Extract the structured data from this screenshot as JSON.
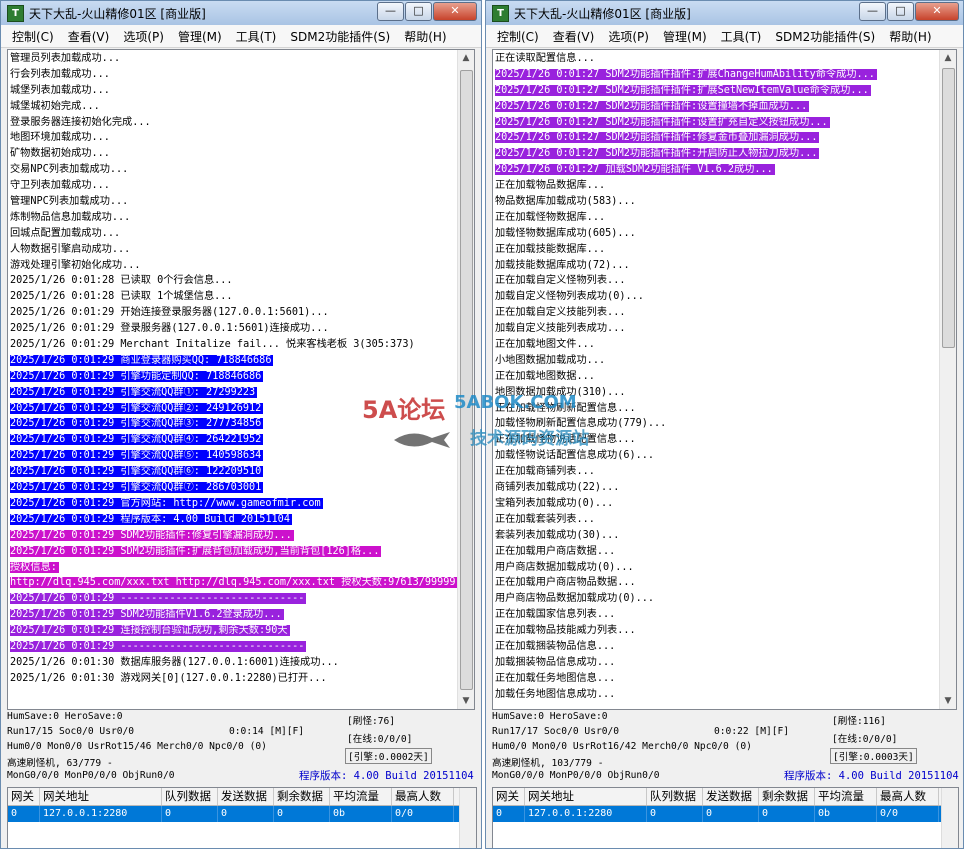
{
  "left": {
    "title": "天下大乱-火山精修01区 [商业版]",
    "buttons": {
      "min": "—",
      "max": "□",
      "close": "✕"
    },
    "menu": [
      "控制(C)",
      "查看(V)",
      "选项(P)",
      "管理(M)",
      "工具(T)",
      "SDM2功能插件(S)",
      "帮助(H)"
    ],
    "log": [
      {
        "t": "管理员列表加载成功...",
        "h": ""
      },
      {
        "t": "行会列表加载成功...",
        "h": ""
      },
      {
        "t": "城堡列表加载成功...",
        "h": ""
      },
      {
        "t": "城堡城初始完成...",
        "h": ""
      },
      {
        "t": "登录服务器连接初始化完成...",
        "h": ""
      },
      {
        "t": "地图环境加载成功...",
        "h": ""
      },
      {
        "t": "矿物数据初始成功...",
        "h": ""
      },
      {
        "t": "交易NPC列表加载成功...",
        "h": ""
      },
      {
        "t": "守卫列表加载成功...",
        "h": ""
      },
      {
        "t": "管理NPC列表加载成功...",
        "h": ""
      },
      {
        "t": "炼制物品信息加载成功...",
        "h": ""
      },
      {
        "t": "回城点配置加载成功...",
        "h": ""
      },
      {
        "t": "人物数据引擎启动成功...",
        "h": ""
      },
      {
        "t": "游戏处理引擎初始化成功...",
        "h": ""
      },
      {
        "t": "2025/1/26 0:01:28 已读取 0个行会信息...",
        "h": ""
      },
      {
        "t": "2025/1/26 0:01:28 已读取 1个城堡信息...",
        "h": ""
      },
      {
        "t": "2025/1/26 0:01:29 开始连接登录服务器(127.0.0.1:5601)...",
        "h": ""
      },
      {
        "t": "2025/1/26 0:01:29 登录服务器(127.0.0.1:5601)连接成功...",
        "h": ""
      },
      {
        "t": "2025/1/26 0:01:29 Merchant Initalize fail... 悦来客栈老板 3(305:373)",
        "h": ""
      },
      {
        "t": "2025/1/26 0:01:29 商业登录器购买QQ: 718846686",
        "h": "blue"
      },
      {
        "t": "2025/1/26 0:01:29 引擎功能定制QQ: 718846686",
        "h": "blue"
      },
      {
        "t": "2025/1/26 0:01:29 引擎交流QQ群①: 27299223",
        "h": "blue"
      },
      {
        "t": "2025/1/26 0:01:29 引擎交流QQ群②: 249126912",
        "h": "blue"
      },
      {
        "t": "2025/1/26 0:01:29 引擎交流QQ群③: 277734856",
        "h": "blue"
      },
      {
        "t": "2025/1/26 0:01:29 引擎交流QQ群④: 264221952",
        "h": "blue"
      },
      {
        "t": "2025/1/26 0:01:29 引擎交流QQ群⑤: 140598634",
        "h": "blue"
      },
      {
        "t": "2025/1/26 0:01:29 引擎交流QQ群⑥: 122209510",
        "h": "blue"
      },
      {
        "t": "2025/1/26 0:01:29 引擎交流QQ群⑦: 286703001",
        "h": "blue"
      },
      {
        "t": "2025/1/26 0:01:29 官方网站: http://www.gameofmir.com",
        "h": "blue"
      },
      {
        "t": "2025/1/26 0:01:29 程序版本: 4.00 Build 20151104",
        "h": "blue"
      },
      {
        "t": "2025/1/26 0:01:29 SDM2功能插件:修复引擎漏洞成功...",
        "h": "mag"
      },
      {
        "t": "2025/1/26 0:01:29 SDM2功能插件:扩展背包加载成功,当前背包[126]格...",
        "h": "mag"
      },
      {
        "t": "授权信息:",
        "h": "mag"
      },
      {
        "t": "http://dlq.945.com/xxx.txt http://dlq.945.com/xxx.txt 授权天数:97613/99999",
        "h": "mag"
      },
      {
        "t": "2025/1/26 0:01:29 ------------------------------",
        "h": "vio"
      },
      {
        "t": "2025/1/26 0:01:29 SDM2功能插件V1.6.2登录成功...",
        "h": "vio"
      },
      {
        "t": "2025/1/26 0:01:29 连接控制台验证成功,剩余天数:90天",
        "h": "vio"
      },
      {
        "t": "2025/1/26 0:01:29 ------------------------------",
        "h": "vio"
      },
      {
        "t": "2025/1/26 0:01:30 数据库服务器(127.0.0.1:6001)连接成功...",
        "h": ""
      },
      {
        "t": "2025/1/26 0:01:30 游戏网关[0](127.0.0.1:2280)已打开...",
        "h": ""
      }
    ],
    "status": {
      "r1": "HumSave:0 HeroSave:0",
      "r2a": "Run17/15 Soc0/0 Usr0/0",
      "r2b": "0:0:14 [M][F]",
      "r3": "Hum0/0 Mon0/0 UsrRot15/46 Merch0/0 Npc0/0 (0)",
      "r4": "高速刷怪机, 63/779 -",
      "r5": "MonG0/0/0 MonP0/0/0 ObjRun0/0",
      "brush": "[刷怪:76]",
      "online": "[在线:0/0/0]",
      "engine": "[引擎:0.0002天]",
      "version": "程序版本: 4.00 Build 20151104"
    },
    "grid": {
      "headers": [
        "网关",
        "网关地址",
        "队列数据",
        "发送数据",
        "剩余数据",
        "平均流量",
        "最高人数"
      ],
      "row": [
        "0",
        "127.0.0.1:2280",
        "0",
        "0",
        "0",
        "0b",
        "0/0"
      ]
    }
  },
  "right": {
    "title": "天下大乱-火山精修01区 [商业版]",
    "buttons": {
      "min": "—",
      "max": "□",
      "close": "✕"
    },
    "menu": [
      "控制(C)",
      "查看(V)",
      "选项(P)",
      "管理(M)",
      "工具(T)",
      "SDM2功能插件(S)",
      "帮助(H)"
    ],
    "log": [
      {
        "t": "正在读取配置信息...",
        "h": ""
      },
      {
        "t": "2025/1/26 0:01:27 SDM2功能插件插件:扩展ChangeHumAbility命令成功...",
        "h": "vio"
      },
      {
        "t": "2025/1/26 0:01:27 SDM2功能插件插件:扩展SetNewItemValue命令成功...",
        "h": "vio"
      },
      {
        "t": "2025/1/26 0:01:27 SDM2功能插件插件:设置撞墙不掉血成功...",
        "h": "vio"
      },
      {
        "t": "2025/1/26 0:01:27 SDM2功能插件插件:设置扩充自定义按钮成功...",
        "h": "vio"
      },
      {
        "t": "2025/1/26 0:01:27 SDM2功能插件插件:修复金币叠加漏洞成功...",
        "h": "vio"
      },
      {
        "t": "2025/1/26 0:01:27 SDM2功能插件插件:开启防止人物拉刀成功...",
        "h": "vio"
      },
      {
        "t": "2025/1/26 0:01:27 加载SDM2功能插件 V1.6.2成功...",
        "h": "vio"
      },
      {
        "t": "正在加载物品数据库...",
        "h": ""
      },
      {
        "t": "物品数据库加载成功(583)...",
        "h": ""
      },
      {
        "t": "正在加载怪物数据库...",
        "h": ""
      },
      {
        "t": "加载怪物数据库成功(605)...",
        "h": ""
      },
      {
        "t": "正在加载技能数据库...",
        "h": ""
      },
      {
        "t": "加载技能数据库成功(72)...",
        "h": ""
      },
      {
        "t": "正在加载自定义怪物列表...",
        "h": ""
      },
      {
        "t": "加载自定义怪物列表成功(0)...",
        "h": ""
      },
      {
        "t": "正在加载自定义技能列表...",
        "h": ""
      },
      {
        "t": "加载自定义技能列表成功...",
        "h": ""
      },
      {
        "t": "正在加载地图文件...",
        "h": ""
      },
      {
        "t": "小地图数据加载成功...",
        "h": ""
      },
      {
        "t": "正在加载地图数据...",
        "h": ""
      },
      {
        "t": "地图数据加载成功(310)...",
        "h": ""
      },
      {
        "t": "正在加载怪物刷新配置信息...",
        "h": ""
      },
      {
        "t": "加载怪物刷新配置信息成功(779)...",
        "h": ""
      },
      {
        "t": "正在加载怪物说话配置信息...",
        "h": ""
      },
      {
        "t": "加载怪物说话配置信息成功(6)...",
        "h": ""
      },
      {
        "t": "正在加载商铺列表...",
        "h": ""
      },
      {
        "t": "商铺列表加载成功(22)...",
        "h": ""
      },
      {
        "t": "宝箱列表加载成功(0)...",
        "h": ""
      },
      {
        "t": "正在加载套装列表...",
        "h": ""
      },
      {
        "t": "套装列表加载成功(30)...",
        "h": ""
      },
      {
        "t": "正在加载用户商店数据...",
        "h": ""
      },
      {
        "t": "用户商店数据加载成功(0)...",
        "h": ""
      },
      {
        "t": "正在加载用户商店物品数据...",
        "h": ""
      },
      {
        "t": "用户商店物品数据加载成功(0)...",
        "h": ""
      },
      {
        "t": "正在加载国家信息列表...",
        "h": ""
      },
      {
        "t": "正在加载物品技能威力列表...",
        "h": ""
      },
      {
        "t": "正在加载捆装物品信息...",
        "h": ""
      },
      {
        "t": "加载捆装物品信息成功...",
        "h": ""
      },
      {
        "t": "正在加载任务地图信息...",
        "h": ""
      },
      {
        "t": "加载任务地图信息成功...",
        "h": ""
      }
    ],
    "status": {
      "r1": "HumSave:0 HeroSave:0",
      "r2a": "Run17/17 Soc0/0 Usr0/0",
      "r2b": "0:0:22 [M][F]",
      "r3": "Hum0/0 Mon0/0 UsrRot16/42 Merch0/0 Npc0/0 (0)",
      "r4": "高速刷怪机, 103/779 -",
      "r5": "MonG0/0/0 MonP0/0/0 ObjRun0/0",
      "brush": "[刷怪:116]",
      "online": "[在线:0/0/0]",
      "engine": "[引擎:0.0003天]",
      "version": "程序版本: 4.00 Build 20151104"
    },
    "grid": {
      "headers": [
        "网关",
        "网关地址",
        "队列数据",
        "发送数据",
        "剩余数据",
        "平均流量",
        "最高人数"
      ],
      "row": [
        "0",
        "127.0.0.1:2280",
        "0",
        "0",
        "0",
        "0b",
        "0/0"
      ]
    }
  },
  "watermark": {
    "logo": "5A论坛",
    "site": "5ABOK.COM",
    "slogan": "技术源码资源站"
  }
}
